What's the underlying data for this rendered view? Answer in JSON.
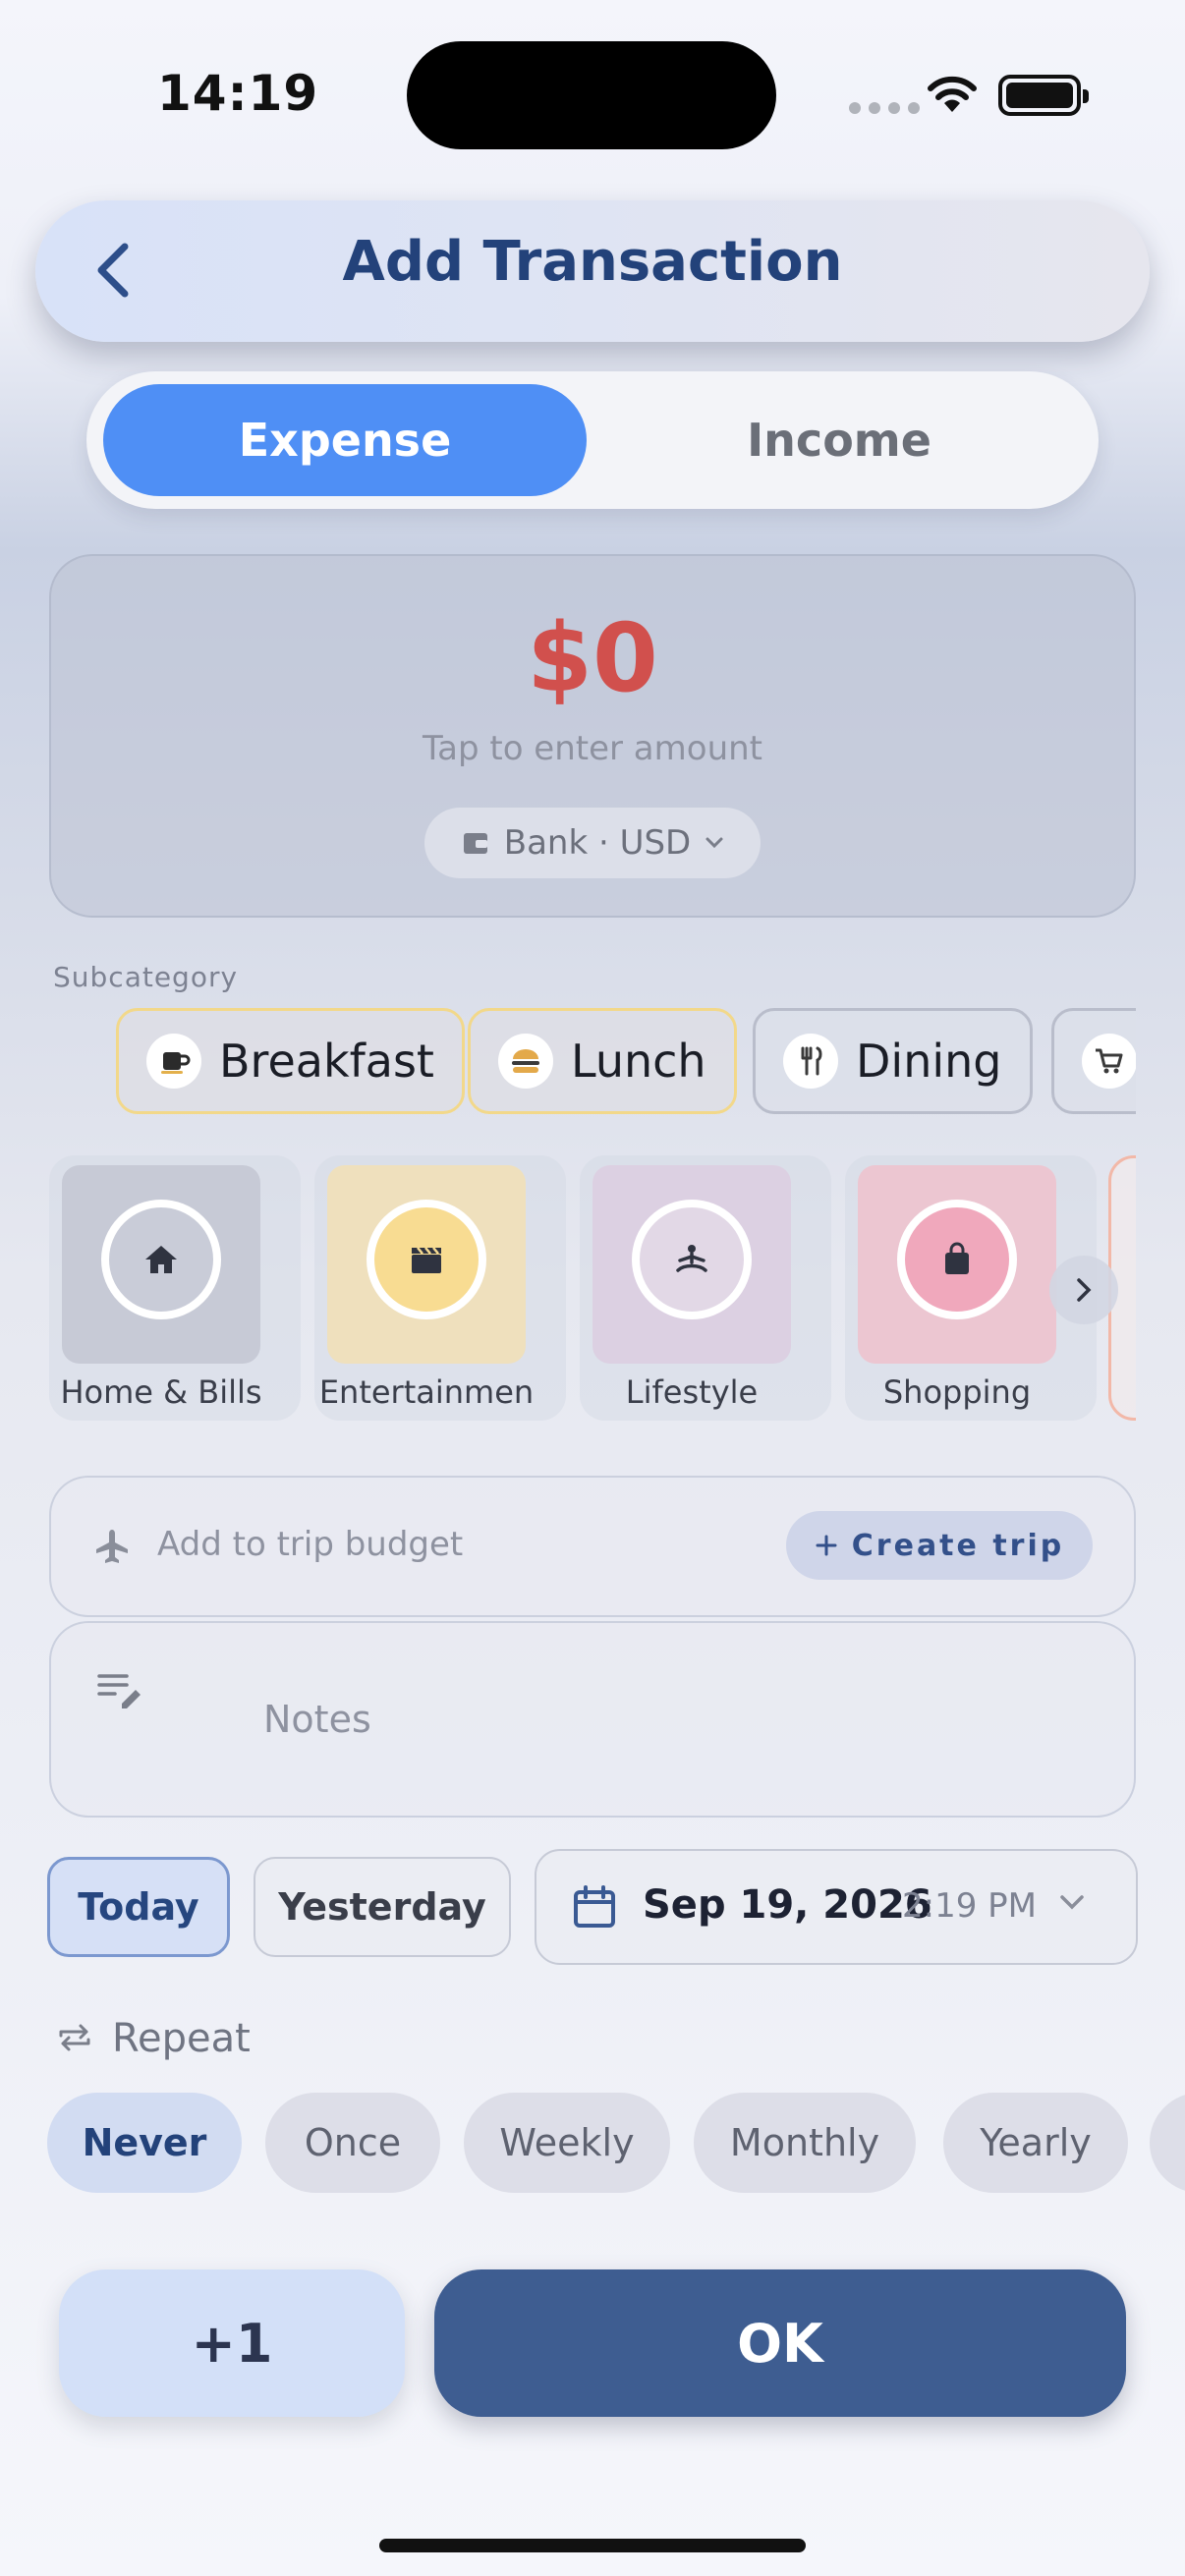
{
  "status": {
    "time": "14:19"
  },
  "header": {
    "title": "Add Transaction"
  },
  "segments": {
    "expense": "Expense",
    "income": "Income"
  },
  "amount": {
    "value": "$0",
    "hint": "Tap to enter amount",
    "account": "Bank · USD"
  },
  "subcategory": {
    "label": "Subcategory",
    "items": [
      {
        "label": "Breakfast",
        "icon": "coffee-icon",
        "selected": true
      },
      {
        "label": "Lunch",
        "icon": "burger-icon",
        "selected": true
      },
      {
        "label": "Dining",
        "icon": "utensils-icon",
        "selected": false
      },
      {
        "label": "",
        "icon": "cart-icon",
        "selected": false
      }
    ]
  },
  "categories": {
    "items": [
      {
        "label": "Home & Bills",
        "icon": "home-icon",
        "color": "#c7cad6"
      },
      {
        "label": "Entertainmen",
        "icon": "clapperboard-icon",
        "color": "#efe0bd"
      },
      {
        "label": "Lifestyle",
        "icon": "meditation-icon",
        "color": "#dcd0e2"
      },
      {
        "label": "Shopping",
        "icon": "shopping-bag-icon",
        "color": "#ecc6d1"
      }
    ]
  },
  "trip": {
    "placeholder": "Add to trip budget",
    "create_label": "Create trip"
  },
  "notes": {
    "placeholder": "Notes"
  },
  "date": {
    "today": "Today",
    "yesterday": "Yesterday",
    "date": "Sep 19, 2026",
    "time": "2:19 PM"
  },
  "repeat": {
    "label": "Repeat",
    "options": [
      "Never",
      "Once",
      "Weekly",
      "Monthly",
      "Yearly"
    ],
    "selected": "Never"
  },
  "actions": {
    "plus": "+1",
    "ok": "OK"
  },
  "colors": {
    "accent": "#4f8ff5",
    "primary": "#3e5d91",
    "amount": "#d1504d"
  }
}
